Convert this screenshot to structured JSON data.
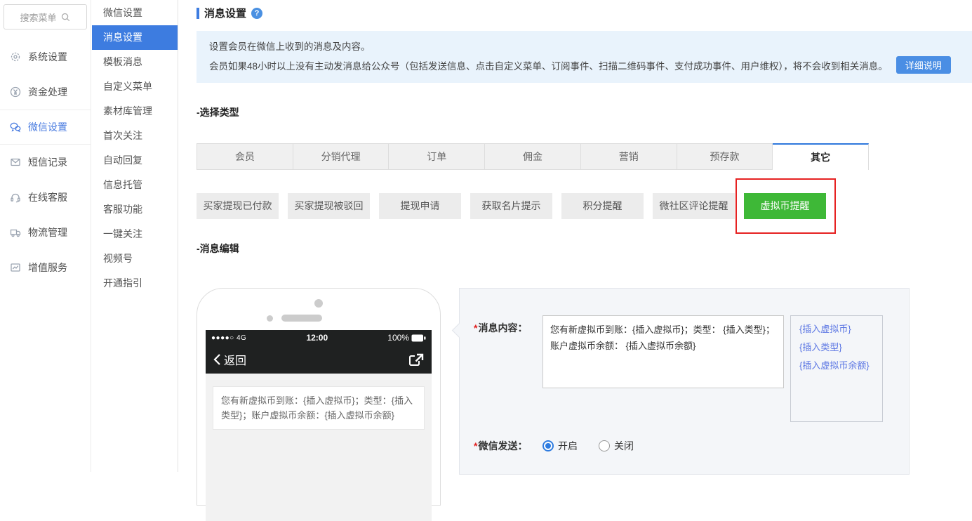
{
  "sidebar": {
    "search_placeholder": "搜索菜单",
    "items": [
      {
        "label": "系统设置",
        "icon": "gear-icon"
      },
      {
        "label": "资金处理",
        "icon": "yen-icon"
      },
      {
        "label": "微信设置",
        "icon": "wechat-icon"
      },
      {
        "label": "短信记录",
        "icon": "sms-icon"
      },
      {
        "label": "在线客服",
        "icon": "headset-icon"
      },
      {
        "label": "物流管理",
        "icon": "truck-icon"
      },
      {
        "label": "增值服务",
        "icon": "chart-icon"
      }
    ],
    "active_item": "微信设置"
  },
  "submenu": {
    "items": [
      "微信设置",
      "消息设置",
      "模板消息",
      "自定义菜单",
      "素材库管理",
      "首次关注",
      "自动回复",
      "信息托管",
      "客服功能",
      "一键关注",
      "视频号",
      "开通指引"
    ],
    "active_item": "消息设置"
  },
  "header": {
    "title": "消息设置"
  },
  "notice": {
    "line1": "设置会员在微信上收到的消息及内容。",
    "line2": "会员如果48小时以上没有主动发消息给公众号（包括发送信息、点击自定义菜单、订阅事件、扫描二维码事件、支付成功事件、用户维权），将不会收到相关消息。",
    "button_label": "详细说明"
  },
  "type_section": {
    "label": "-选择类型",
    "tabs": [
      "会员",
      "分销代理",
      "订单",
      "佣金",
      "营销",
      "预存款",
      "其它"
    ],
    "active_tab": "其它",
    "buttons": [
      "买家提现已付款",
      "买家提现被驳回",
      "提现申请",
      "获取名片提示",
      "积分提醒",
      "微社区评论提醒",
      "虚拟币提醒"
    ],
    "selected_button": "虚拟币提醒"
  },
  "edit_section": {
    "label": "-消息编辑",
    "phone": {
      "network": "●●●●○ 4G",
      "time": "12:00",
      "battery": "100%",
      "back_label": "返回",
      "message_preview": "您有新虚拟币到账：{插入虚拟币}；类型：{插入类型}；账户虚拟币余额：{插入虚拟币余额}"
    },
    "form": {
      "content_label": "消息内容：",
      "content_value": "您有新虚拟币到账：{插入虚拟币}；类型： {插入类型}；账户虚拟币余额： {插入虚拟币余额}",
      "insert_links": [
        "{插入虚拟币}",
        "{插入类型}",
        "{插入虚拟币余额}"
      ],
      "send_label": "微信发送：",
      "options": [
        {
          "label": "开启",
          "checked": true
        },
        {
          "label": "关闭",
          "checked": false
        }
      ]
    }
  },
  "colors": {
    "accent_blue": "#3d7ce0",
    "notice_bg": "#e9f3fc",
    "selected_green": "#3eb837",
    "annotation_red": "#e62222",
    "link_blue": "#5b76e3"
  }
}
